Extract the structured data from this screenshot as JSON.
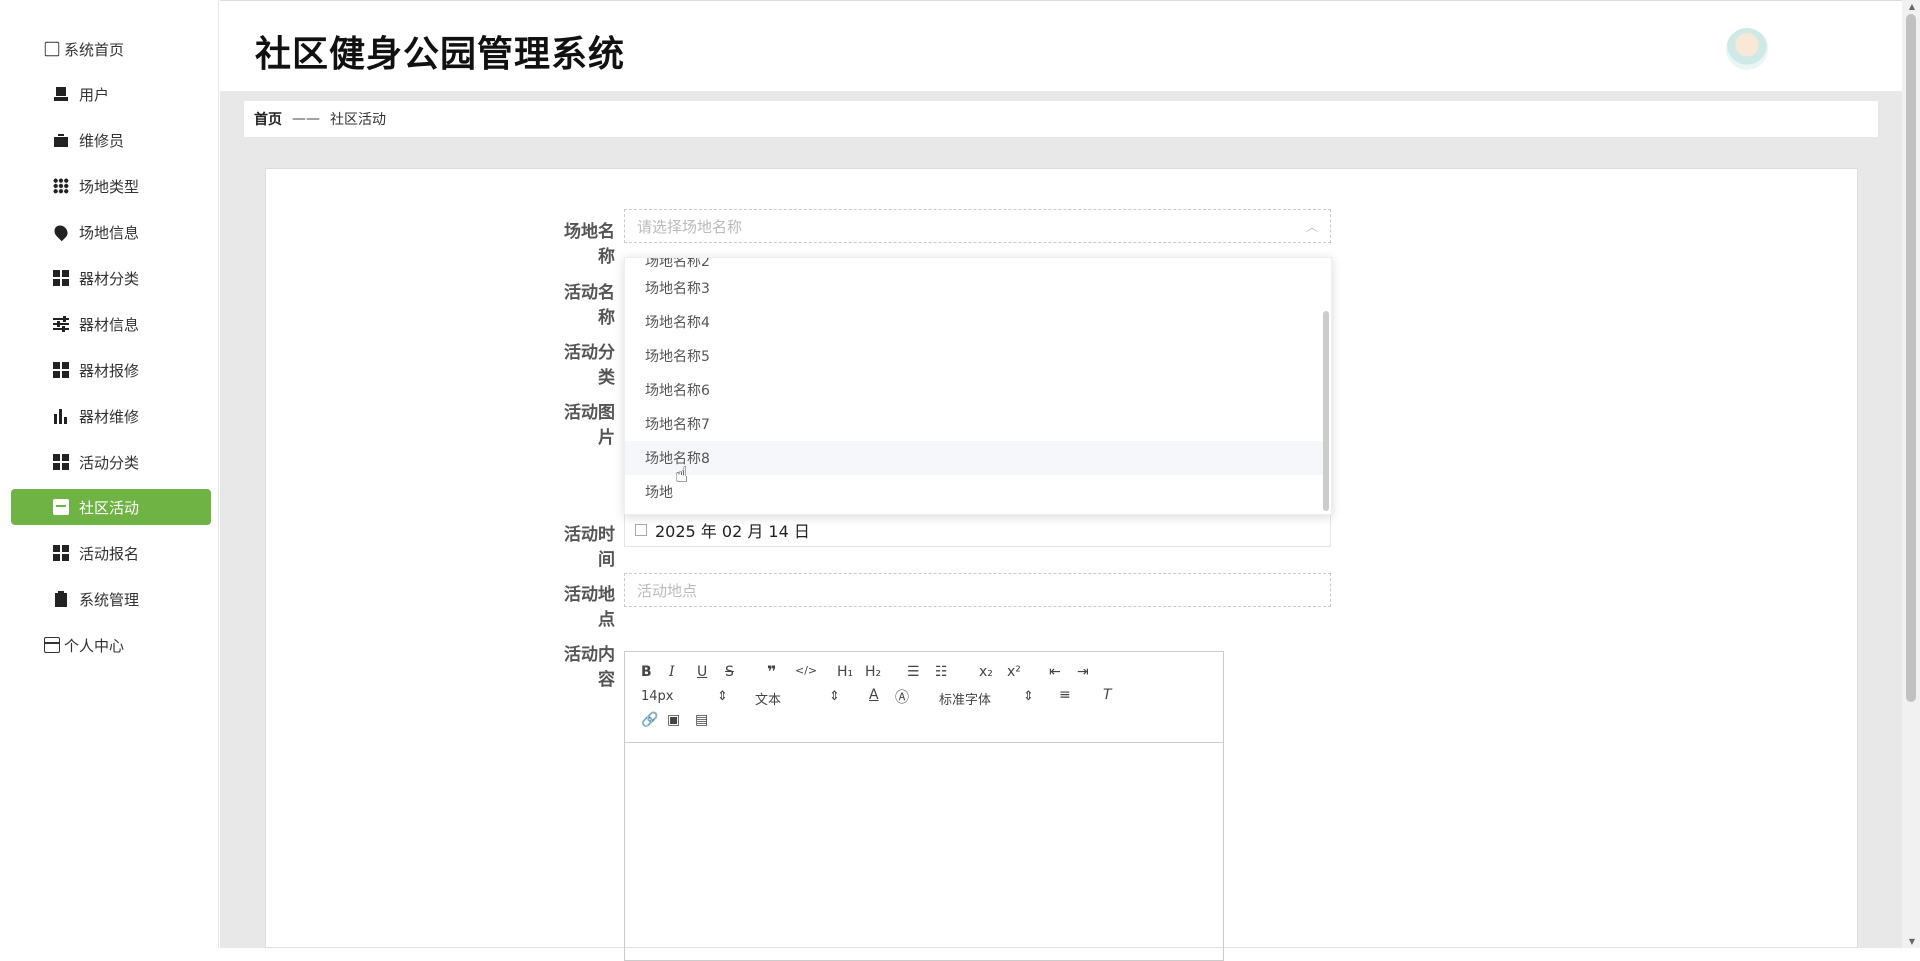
{
  "app": {
    "title": "社区健身公园管理系统"
  },
  "sidebar": {
    "items": [
      {
        "label": "系统首页",
        "icon": "home-icon"
      },
      {
        "label": "用户",
        "icon": "user-icon"
      },
      {
        "label": "维修员",
        "icon": "briefcase-icon"
      },
      {
        "label": "场地类型",
        "icon": "grid-icon"
      },
      {
        "label": "场地信息",
        "icon": "pin-icon"
      },
      {
        "label": "器材分类",
        "icon": "grid-icon"
      },
      {
        "label": "器材信息",
        "icon": "sliders-icon"
      },
      {
        "label": "器材报修",
        "icon": "grid-icon"
      },
      {
        "label": "器材维修",
        "icon": "bar-chart-icon"
      },
      {
        "label": "活动分类",
        "icon": "grid-icon"
      },
      {
        "label": "社区活动",
        "icon": "chat-icon",
        "active": true
      },
      {
        "label": "活动报名",
        "icon": "grid-icon"
      },
      {
        "label": "系统管理",
        "icon": "clipboard-icon"
      },
      {
        "label": "个人中心",
        "icon": "card-icon"
      }
    ]
  },
  "breadcrumb": {
    "home": "首页",
    "separator": "——",
    "current": "社区活动"
  },
  "form": {
    "venue_label": "场地名称",
    "venue_placeholder": "请选择场地名称",
    "activity_name_label": "活动名称",
    "activity_category_label": "活动分类",
    "activity_image_label": "活动图片",
    "activity_time_label": "活动时间",
    "activity_time_value": "2025 年 02 月 14 日",
    "activity_location_label": "活动地点",
    "activity_location_placeholder": "活动地点",
    "activity_content_label": "活动内容"
  },
  "dropdown": {
    "options": [
      "场地名称2",
      "场地名称3",
      "场地名称4",
      "场地名称5",
      "场地名称6",
      "场地名称7",
      "场地名称8",
      "场地"
    ],
    "hovered": "场地名称8"
  },
  "editor": {
    "font_size": "14px",
    "header_select": "文本",
    "font_family": "标准字体"
  },
  "colors": {
    "accent": "#6fb344"
  }
}
